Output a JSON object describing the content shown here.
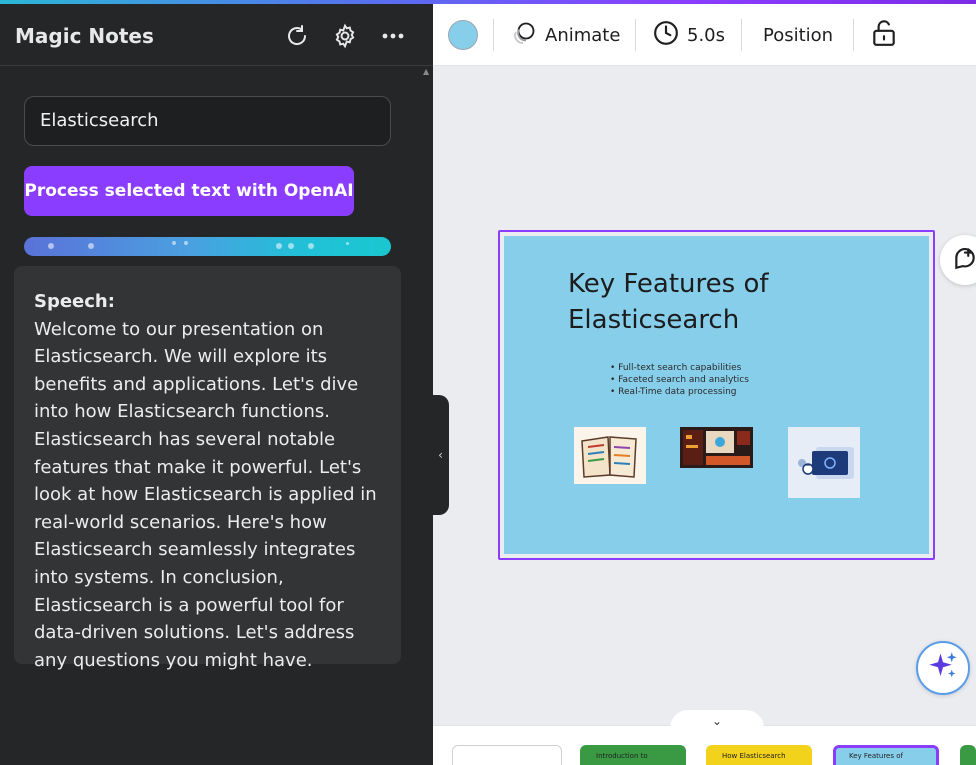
{
  "panel": {
    "title": "Magic Notes",
    "input_value": "Elasticsearch",
    "process_button": "Process selected text with OpenAI",
    "speech_label": "Speech:",
    "speech_text": "Welcome to our presentation on Elasticsearch. We will explore its benefits and applications. Let's dive into how Elasticsearch functions. Elasticsearch has several notable features that make it powerful. Let's look at how Elasticsearch is applied in real-world scenarios. Here's how Elasticsearch seamlessly integrates into systems. In conclusion, Elasticsearch is a powerful tool for data-driven solutions. Let's address any questions you might have."
  },
  "toolbar": {
    "color": "#87ceeb",
    "animate": "Animate",
    "duration": "5.0s",
    "position": "Position"
  },
  "slide": {
    "title": "Key Features of Elasticsearch",
    "bullets": [
      "• Full-text search capabilities",
      "• Faceted search and analytics",
      "• Real-Time data processing"
    ],
    "background": "#87ceeb"
  },
  "thumbnails": [
    {
      "label": "",
      "color": "#ffffff"
    },
    {
      "label": "Introduction to",
      "color": "#3a9a44"
    },
    {
      "label": "How Elasticsearch",
      "color": "#f2d21a"
    },
    {
      "label": "Key Features of",
      "color": "#87ceeb"
    },
    {
      "label": "",
      "color": "#3a9a44"
    }
  ],
  "accent": "#8b3dff"
}
